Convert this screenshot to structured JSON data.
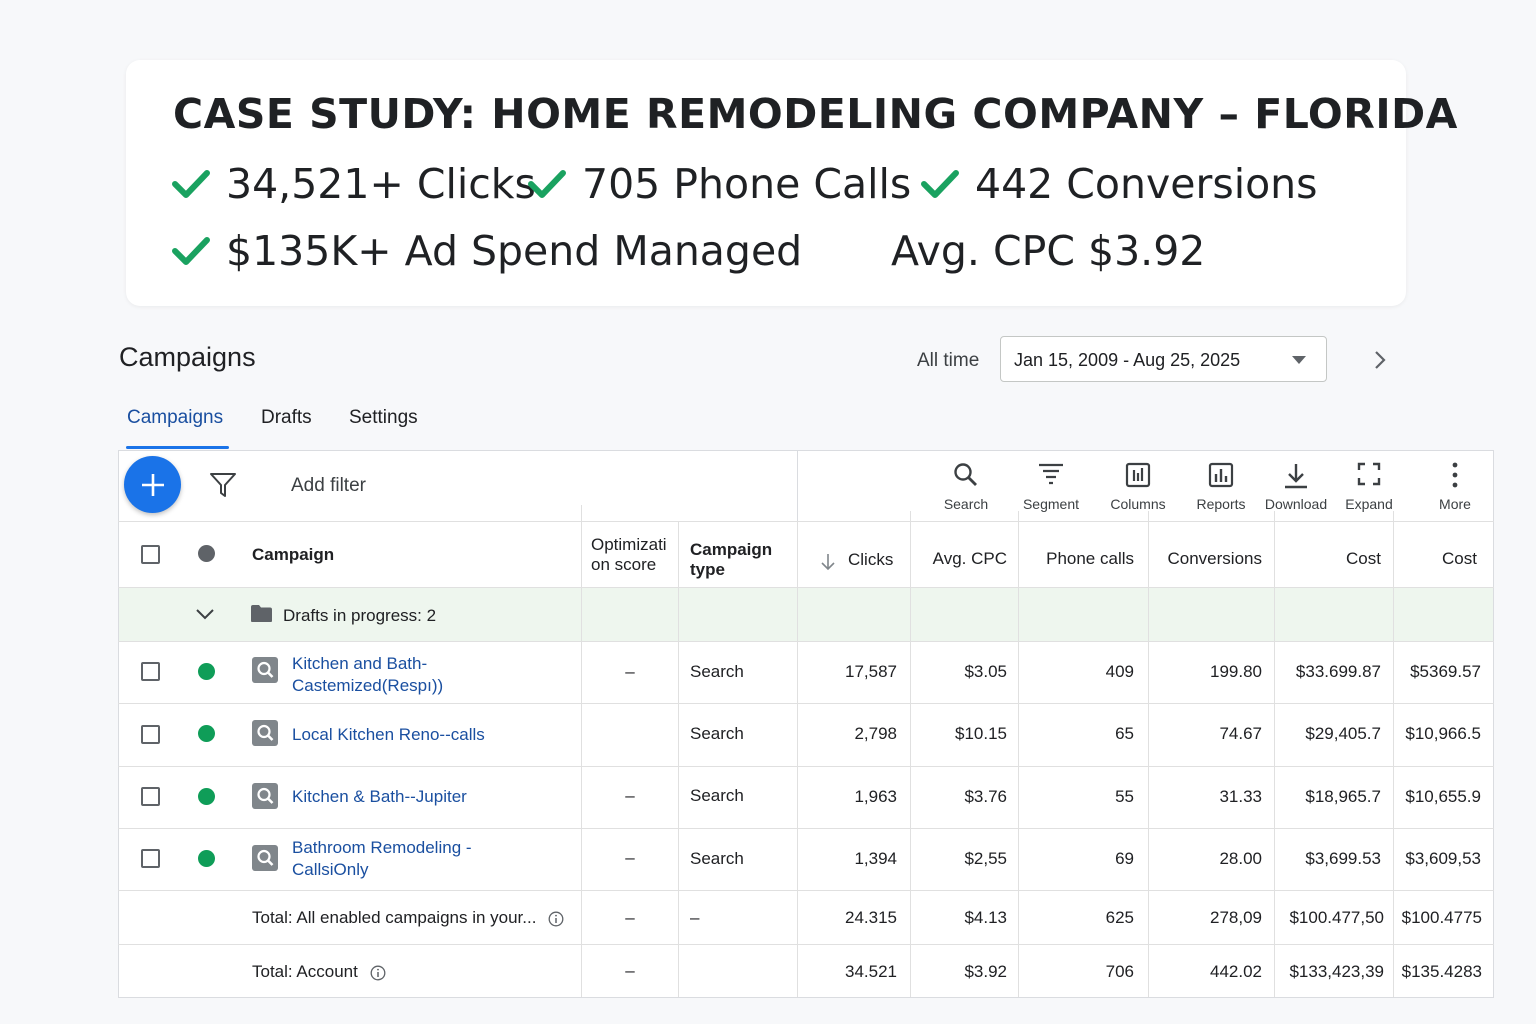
{
  "case_study": {
    "title": "CASE STUDY: HOME REMODELING COMPANY – FLORIDA",
    "stats": [
      {
        "text": "34,521+ Clicks",
        "check": true
      },
      {
        "text": "705 Phone Calls",
        "check": true
      },
      {
        "text": "442 Conversions",
        "check": true
      },
      {
        "text": "$135K+ Ad Spend Managed",
        "check": true
      },
      {
        "text": "Avg. CPC $3.92",
        "check": false
      }
    ],
    "check_color": "#1aa260"
  },
  "header": {
    "title": "Campaigns",
    "range_label": "All time",
    "date_range": "Jan 15, 2009 - Aug 25, 2025"
  },
  "tabs": [
    {
      "label": "Campaigns",
      "active": true
    },
    {
      "label": "Drafts",
      "active": false
    },
    {
      "label": "Settings",
      "active": false
    }
  ],
  "toolbar": {
    "add_filter": "Add filter",
    "tools": [
      {
        "label": "Search",
        "icon": "search-icon"
      },
      {
        "label": "Segment",
        "icon": "segment-icon"
      },
      {
        "label": "Columns",
        "icon": "columns-icon"
      },
      {
        "label": "Reports",
        "icon": "reports-icon"
      },
      {
        "label": "Download",
        "icon": "download-icon"
      },
      {
        "label": "Expand",
        "icon": "expand-icon"
      },
      {
        "label": "More",
        "icon": "more-vert-icon"
      }
    ]
  },
  "table": {
    "columns": {
      "campaign": "Campaign",
      "opt_score_1": "Optimizati",
      "opt_score_2": "on score",
      "type_1": "Campaign",
      "type_2": "type",
      "clicks": "Clicks",
      "avg_cpc": "Avg. CPC",
      "phone_calls": "Phone calls",
      "conversions": "Conversions",
      "cost": "Cost",
      "cost2": "Cost"
    },
    "drafts_row": "Drafts in progress: 2",
    "rows": [
      {
        "name_1": "Kitchen and Bath-",
        "name_2": "Castemized(Respı))",
        "opt": "–",
        "type": "Search",
        "clicks": "17,587",
        "cpc": "$3.05",
        "calls": "409",
        "conv": "199.80",
        "cost": "$33.699.87",
        "cost2": "$5369.57"
      },
      {
        "name_1": "Local Kitchen Reno--calls",
        "name_2": "",
        "opt": "",
        "type": "Search",
        "clicks": "2,798",
        "cpc": "$10.15",
        "calls": "65",
        "conv": "74.67",
        "cost": "$29,405.7",
        "cost2": "$10,966.5"
      },
      {
        "name_1": "Kitchen & Bath--Jupiter",
        "name_2": "",
        "opt": "–",
        "type": "Search",
        "clicks": "1,963",
        "cpc": "$3.76",
        "calls": "55",
        "conv": "31.33",
        "cost": "$18,965.7",
        "cost2": "$10,655.9"
      },
      {
        "name_1": "Bathroom Remodeling -",
        "name_2": "CallsiOnly",
        "opt": "–",
        "type": "Search",
        "clicks": "1,394",
        "cpc": "$2,55",
        "calls": "69",
        "conv": "28.00",
        "cost": "$3,699.53",
        "cost2": "$3,609,53"
      }
    ],
    "totals": [
      {
        "label": "Total: All enabled campaigns in your...",
        "opt": "–",
        "type": "–",
        "clicks": "24.315",
        "cpc": "$4.13",
        "calls": "625",
        "conv": "278,09",
        "cost": "$100.477,50",
        "cost2": "$100.4775"
      },
      {
        "label": "Total: Account",
        "opt": "–",
        "type": "",
        "clicks": "34.521",
        "cpc": "$3.92",
        "calls": "706",
        "conv": "442.02",
        "cost": "$133,423,39",
        "cost2": "$135.4283"
      }
    ]
  },
  "colors": {
    "primary_blue": "#1a73e8",
    "link_blue": "#1a4fa0",
    "enabled_green": "#0f9d58",
    "drafts_band": "#eef6ee"
  }
}
